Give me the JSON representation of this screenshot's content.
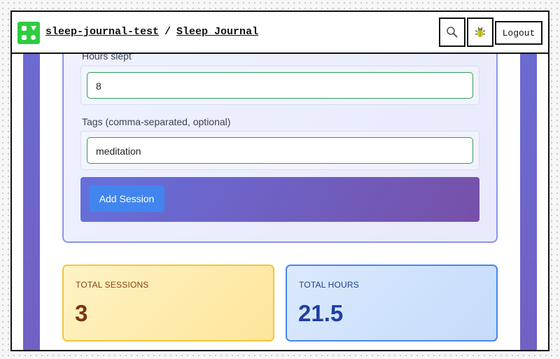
{
  "header": {
    "project": "sleep-journal-test",
    "separator": "/",
    "page": "Sleep Journal",
    "logout_label": "Logout",
    "icons": {
      "logo": "grid-logo-icon",
      "search": "search-icon",
      "bug": "bug-icon"
    },
    "logo_color": "#2ecc40"
  },
  "form": {
    "hours": {
      "label": "Hours slept",
      "value": "8"
    },
    "tags": {
      "label": "Tags (comma-separated, optional)",
      "value": "meditation"
    },
    "submit_label": "Add Session"
  },
  "stats": {
    "sessions": {
      "title": "TOTAL SESSIONS",
      "value": "3"
    },
    "hours": {
      "title": "TOTAL HOURS",
      "value": "21.5"
    }
  }
}
